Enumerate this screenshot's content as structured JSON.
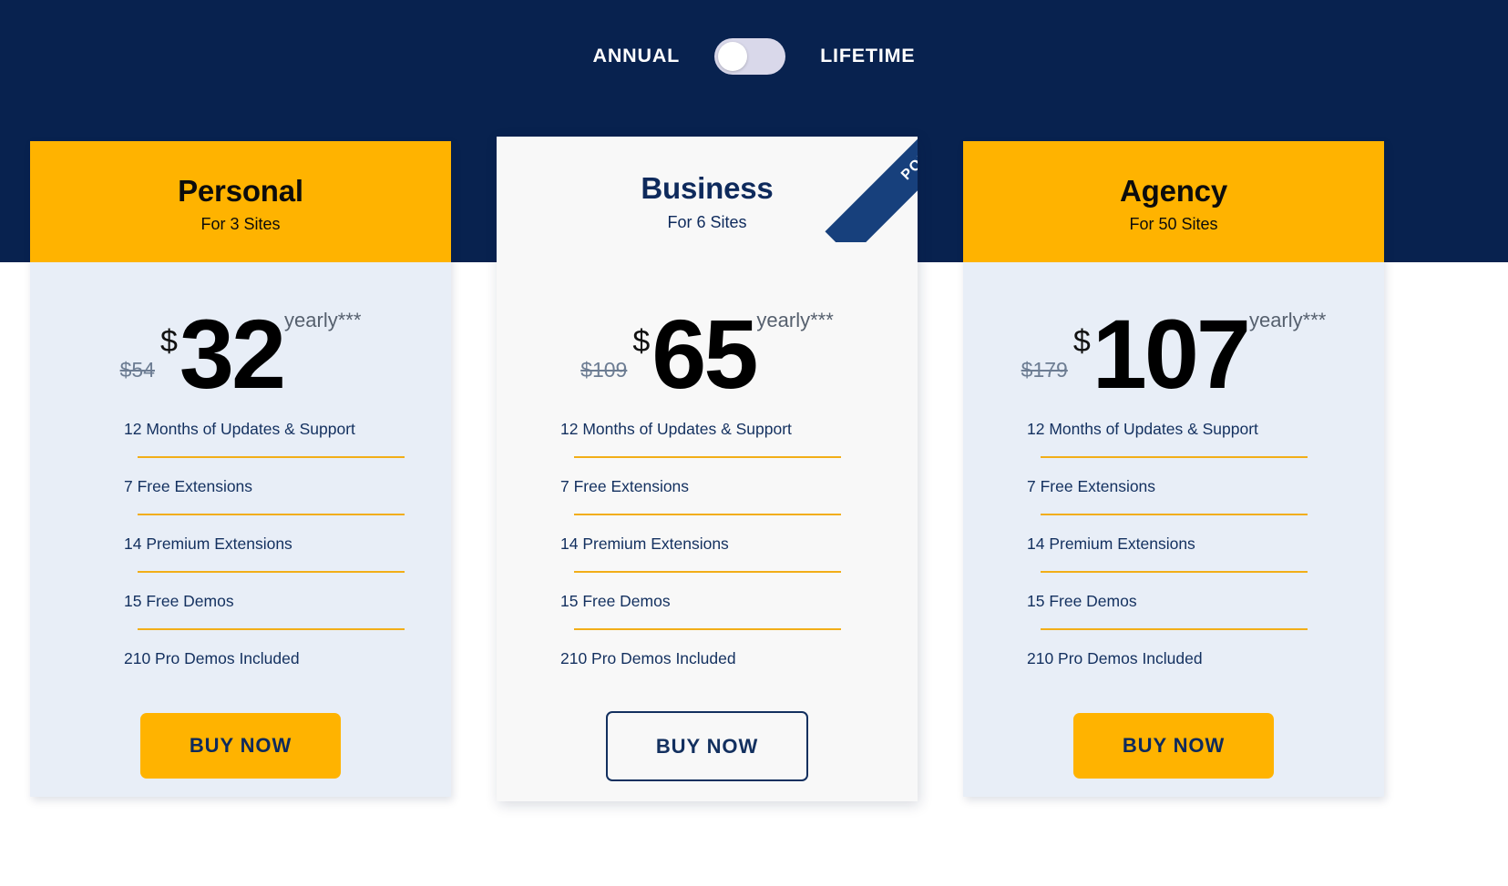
{
  "billing_toggle": {
    "left_label": "ANNUAL",
    "right_label": "LIFETIME",
    "state": "annual",
    "track_color": "#d9d8ea",
    "knob_color": "#ffffff"
  },
  "theme": {
    "navy": "#08224f",
    "amber": "#ffb300",
    "rule": "#f2ae18",
    "card_bg": "#e8eef7",
    "featured_bg": "#f8f8f8",
    "ribbon": "#17407c"
  },
  "plans": [
    {
      "id": "personal",
      "name": "Personal",
      "sites": "For 3 Sites",
      "old_price": "$54",
      "currency": "$",
      "price": "32",
      "period": "yearly***",
      "features": [
        "12 Months of Updates & Support",
        "7 Free Extensions",
        "14 Premium Extensions",
        "15 Free Demos",
        "210 Pro Demos Included"
      ],
      "cta": "BUY NOW",
      "featured": false,
      "badge": ""
    },
    {
      "id": "business",
      "name": "Business",
      "sites": "For 6 Sites",
      "old_price": "$109",
      "currency": "$",
      "price": "65",
      "period": "yearly***",
      "features": [
        "12 Months of Updates & Support",
        "7 Free Extensions",
        "14 Premium Extensions",
        "15 Free Demos",
        "210 Pro Demos Included"
      ],
      "cta": "BUY NOW",
      "featured": true,
      "badge": "POPULAR"
    },
    {
      "id": "agency",
      "name": "Agency",
      "sites": "For 50 Sites",
      "old_price": "$179",
      "currency": "$",
      "price": "107",
      "period": "yearly***",
      "features": [
        "12 Months of Updates & Support",
        "7 Free Extensions",
        "14 Premium Extensions",
        "15 Free Demos",
        "210 Pro Demos Included"
      ],
      "cta": "BUY NOW",
      "featured": false,
      "badge": ""
    }
  ]
}
